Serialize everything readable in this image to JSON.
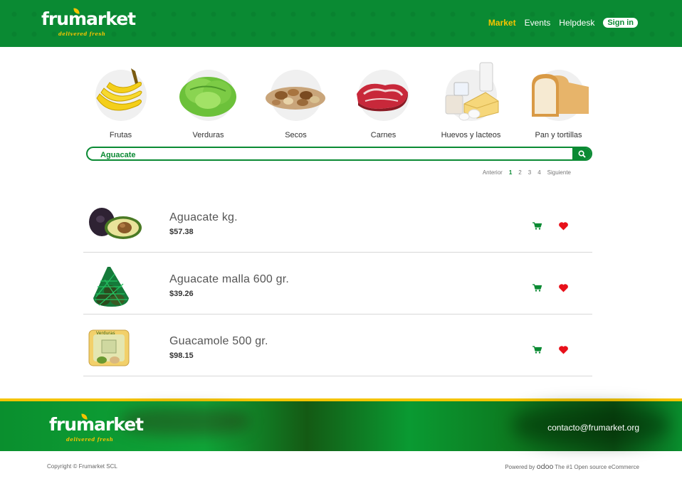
{
  "brand": {
    "name": "frumarket",
    "tagline": "delivered fresh",
    "colors": {
      "primary": "#0a8a33",
      "accent": "#f5c400",
      "heart": "#e8101a"
    }
  },
  "nav": {
    "items": [
      {
        "label": "Market",
        "active": true
      },
      {
        "label": "Events",
        "active": false
      },
      {
        "label": "Helpdesk",
        "active": false
      }
    ],
    "signin": "Sign in"
  },
  "categories": [
    {
      "label": "Frutas",
      "icon": "banana-icon"
    },
    {
      "label": "Verduras",
      "icon": "lettuce-icon"
    },
    {
      "label": "Secos",
      "icon": "nuts-icon"
    },
    {
      "label": "Carnes",
      "icon": "meat-icon"
    },
    {
      "label": "Huevos y lacteos",
      "icon": "dairy-icon"
    },
    {
      "label": "Pan y tortillas",
      "icon": "bread-icon"
    }
  ],
  "search": {
    "value": "Aguacate",
    "icon": "search-icon"
  },
  "pager": {
    "prev": "Anterior",
    "pages": [
      "1",
      "2",
      "3",
      "4"
    ],
    "current": "1",
    "next": "Siguiente"
  },
  "products": [
    {
      "name": "Aguacate kg.",
      "price": "$57.38",
      "image": "avocado-image"
    },
    {
      "name": "Aguacate malla 600 gr.",
      "price": "$39.26",
      "image": "avocado-mesh-image"
    },
    {
      "name": "Guacamole 500 gr.",
      "price": "$98.15",
      "image": "guacamole-image"
    }
  ],
  "footer": {
    "contact": "contacto@frumarket.org",
    "copyright": "Copyright © Frumarket SCL",
    "powered_prefix": "Powered by",
    "powered_brand": "odoo",
    "powered_suffix": "The #1 Open source eCommerce"
  }
}
